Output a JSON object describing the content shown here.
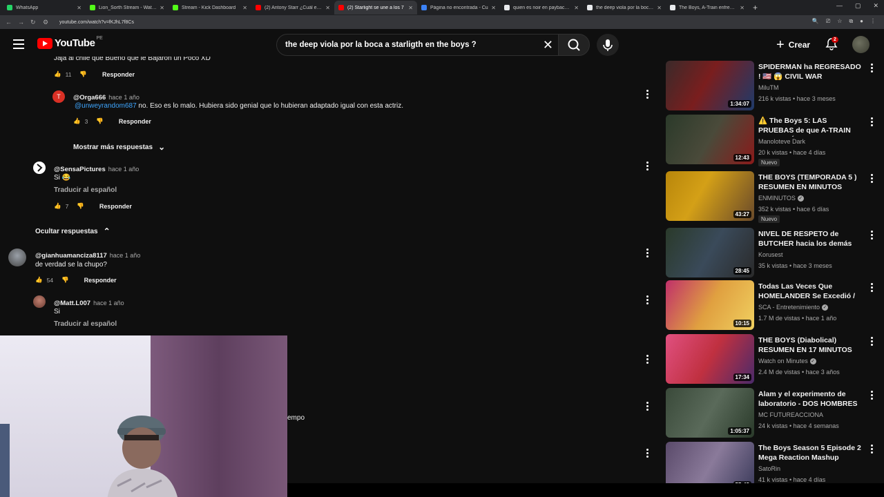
{
  "browser": {
    "tabs": [
      {
        "title": "WhatsApp",
        "color": "#25d366",
        "active": false
      },
      {
        "title": "Lion_Sorth Stream - Watch Live",
        "color": "#53fc18",
        "active": false
      },
      {
        "title": "Stream - Kick Dashboard",
        "color": "#53fc18",
        "active": false
      },
      {
        "title": "(2) Antony Starr ¿Cuál es la",
        "color": "#ff0000",
        "active": false
      },
      {
        "title": "(2) Starlight se une a los 7",
        "color": "#ff0000",
        "active": true
      },
      {
        "title": "Página no encontrada - Cu",
        "color": "#3b82f6",
        "active": false
      },
      {
        "title": "quien es noir en payback de th",
        "color": "#e8eaed",
        "active": false
      },
      {
        "title": "the deep viola por la boca a sta",
        "color": "#e8eaed",
        "active": false
      },
      {
        "title": "The Boys, A-Train enfrenta una",
        "color": "#e8eaed",
        "active": false
      }
    ],
    "url": "youtube.com/watch?v=fKJhL7f8Cs"
  },
  "header": {
    "logo_text": "YouTube",
    "country": "PE",
    "search_value": "the deep viola por la boca a starligth en the boys ?",
    "create_label": "Crear",
    "notifications": "2"
  },
  "comments": {
    "c0_text": "Jaja al chile que Bueno que le Bajaron un Poco XD",
    "c0_likes": "11",
    "c1_author": "@Orga666",
    "c1_time": "hace 1 año",
    "c1_mention": "@unweyrandom687",
    "c1_text": " no. Eso es lo malo. Hubiera sido genial que lo hubieran adaptado igual con esta actriz.",
    "c1_likes": "3",
    "more_replies": "Mostrar más respuestas",
    "c2_author": "@SensaPictures",
    "c2_time": "hace 1 año",
    "c2_text": "Si 😂",
    "c2_translate": "Traducir al español",
    "c2_likes": "7",
    "hide_replies": "Ocultar respuestas",
    "c3_author": "@gianhuamanciza8117",
    "c3_time": "hace 1 año",
    "c3_text": "de verdad se la chupo?",
    "c3_likes": "54",
    "c4_author": "@Matt.L007",
    "c4_time": "hace 1 año",
    "c4_text": "Si",
    "c4_translate": "Traducir al español",
    "reply_label": "Responder",
    "partial_text": "empo"
  },
  "sidebar": {
    "videos": [
      {
        "title": "SPIDERMAN ha REGRESADO ! 🇺🇸 😱 CIVIL WAR REACCION ...",
        "channel": "MiluTM",
        "meta": "216 k vistas • hace 3 meses",
        "duration": "1:34:07",
        "badge": "",
        "verified": false
      },
      {
        "title": "⚠️ The Boys 5: LAS PRUEBAS de que A-TRAIN NO MURIÓ: El...",
        "channel": "Manoloteve Dark",
        "meta": "20 k vistas • hace 4 días",
        "duration": "12:43",
        "badge": "Nuevo",
        "verified": false
      },
      {
        "title": "THE BOYS (TEMPORADA 5 ) RESUMEN EN MINUTOS",
        "channel": "ENMINUTOS",
        "meta": "352 k vistas • hace 6 días",
        "duration": "43:27",
        "badge": "Nuevo",
        "verified": true
      },
      {
        "title": "NIVEL DE RESPETO de BUTCHER hacia los demás en ...",
        "channel": "Korusest",
        "meta": "35 k vistas • hace 3 meses",
        "duration": "28:45",
        "badge": "",
        "verified": false
      },
      {
        "title": "Todas Las Veces Que HOMELANDER Se Excedió / ...",
        "channel": "SCA - Entretenimiento",
        "meta": "1.7 M de vistas • hace 1 año",
        "duration": "10:15",
        "badge": "",
        "verified": true
      },
      {
        "title": "THE BOYS (Diabolical) RESUMEN EN 17 MINUTOS",
        "channel": "Watch on Minutes",
        "meta": "2.4 M de vistas • hace 3 años",
        "duration": "17:34",
        "badge": "",
        "verified": true
      },
      {
        "title": "Alam y el experimento de laboratorio - DOS HOMBRES Y...",
        "channel": "MC FUTUREACCIONA",
        "meta": "24 k vistas • hace 4 semanas",
        "duration": "1:05:37",
        "badge": "",
        "verified": false
      },
      {
        "title": "The Boys Season 5 Episode 2 Mega Reaction Mashup",
        "channel": "SatoRin",
        "meta": "41 k vistas • hace 4 días",
        "duration": "55:48",
        "badge": "",
        "verified": false
      }
    ]
  }
}
